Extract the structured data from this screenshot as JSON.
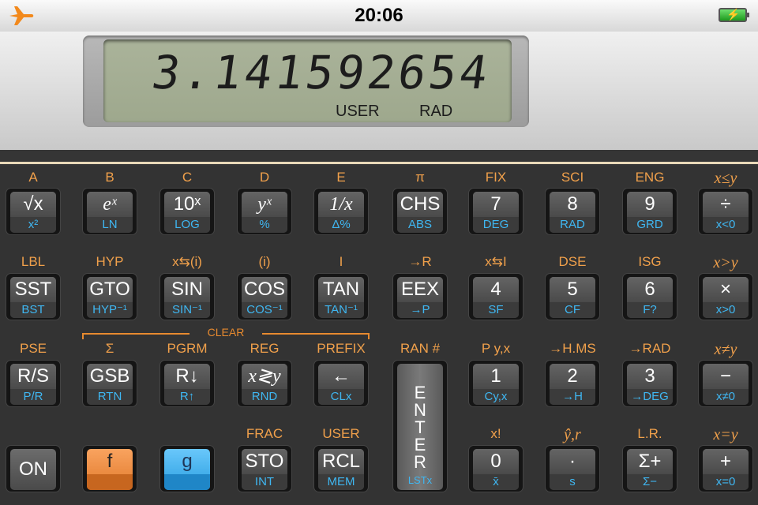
{
  "status_bar": {
    "time": "20:06"
  },
  "display": {
    "value": "3.141592654",
    "annunciators": [
      "USER",
      "RAD"
    ]
  },
  "clear_label": "CLEAR",
  "rows": [
    [
      {
        "f": "A",
        "primary": "√x",
        "secondary": "x²"
      },
      {
        "f": "B",
        "primary": "eˣ",
        "secondary": "LN"
      },
      {
        "f": "C",
        "primary": "10ˣ",
        "secondary": "LOG"
      },
      {
        "f": "D",
        "primary": "yˣ",
        "secondary": "%"
      },
      {
        "f": "E",
        "primary": "1/x",
        "secondary": "Δ%"
      },
      {
        "f": "π",
        "primary": "CHS",
        "secondary": "ABS"
      },
      {
        "f": "FIX",
        "primary": "7",
        "secondary": "DEG"
      },
      {
        "f": "SCI",
        "primary": "8",
        "secondary": "RAD"
      },
      {
        "f": "ENG",
        "primary": "9",
        "secondary": "GRD"
      },
      {
        "f": "x≤y",
        "primary": "÷",
        "secondary": "x<0"
      }
    ],
    [
      {
        "f": "LBL",
        "primary": "SST",
        "secondary": "BST"
      },
      {
        "f": "HYP",
        "primary": "GTO",
        "secondary": "HYP⁻¹"
      },
      {
        "f": "x⇆(i)",
        "primary": "SIN",
        "secondary": "SIN⁻¹"
      },
      {
        "f": "(i)",
        "primary": "COS",
        "secondary": "COS⁻¹"
      },
      {
        "f": "I",
        "primary": "TAN",
        "secondary": "TAN⁻¹"
      },
      {
        "f": "→R",
        "primary": "EEX",
        "secondary": "→P"
      },
      {
        "f": "x⇆I",
        "primary": "4",
        "secondary": "SF"
      },
      {
        "f": "DSE",
        "primary": "5",
        "secondary": "CF"
      },
      {
        "f": "ISG",
        "primary": "6",
        "secondary": "F?"
      },
      {
        "f": "x>y",
        "primary": "×",
        "secondary": "x>0"
      }
    ],
    [
      {
        "f": "PSE",
        "primary": "R/S",
        "secondary": "P/R"
      },
      {
        "f": "Σ",
        "primary": "GSB",
        "secondary": "RTN"
      },
      {
        "f": "PGRM",
        "primary": "R↓",
        "secondary": "R↑"
      },
      {
        "f": "REG",
        "primary": "x≷y",
        "secondary": "RND"
      },
      {
        "f": "PREFIX",
        "primary": "←",
        "secondary": "CLx"
      },
      {
        "f": "RAN #",
        "primary": "",
        "secondary": ""
      },
      {
        "f": "P y,x",
        "primary": "1",
        "secondary": "Cy,x"
      },
      {
        "f": "→H.MS",
        "primary": "2",
        "secondary": "→H"
      },
      {
        "f": "→RAD",
        "primary": "3",
        "secondary": "→DEG"
      },
      {
        "f": "x≠y",
        "primary": "−",
        "secondary": "x≠0"
      }
    ],
    [
      {
        "f": "",
        "primary": "ON",
        "secondary": ""
      },
      {
        "f": "",
        "primary": "f",
        "secondary": ""
      },
      {
        "f": "",
        "primary": "g",
        "secondary": ""
      },
      {
        "f": "FRAC",
        "primary": "STO",
        "secondary": "INT"
      },
      {
        "f": "USER",
        "primary": "RCL",
        "secondary": "MEM"
      },
      {
        "f": "",
        "primary": "",
        "secondary": ""
      },
      {
        "f": "x!",
        "primary": "0",
        "secondary": "x̄"
      },
      {
        "f": "ŷ,r",
        "primary": "·",
        "secondary": "s"
      },
      {
        "f": "L.R.",
        "primary": "Σ+",
        "secondary": "Σ−"
      },
      {
        "f": "x=y",
        "primary": "+",
        "secondary": "x=0"
      }
    ]
  ],
  "enter": {
    "label": "ENTER",
    "secondary": "LSTx"
  }
}
